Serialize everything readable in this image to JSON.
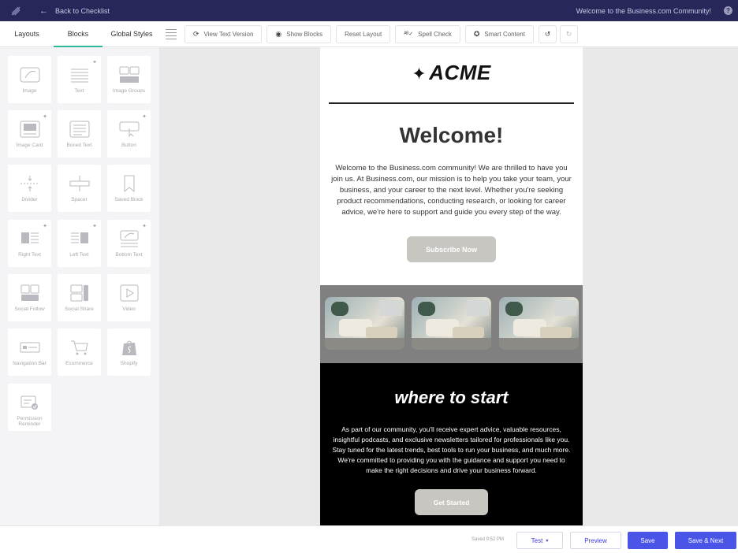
{
  "topbar": {
    "back_label": "Back to Checklist",
    "title": "Welcome to the Business.com Community!",
    "help_label": "?"
  },
  "toolbar": {
    "tabs": [
      {
        "label": "Layouts"
      },
      {
        "label": "Blocks"
      },
      {
        "label": "Global Styles"
      }
    ],
    "active_tab": "Blocks",
    "buttons": [
      {
        "label": "View Text Version",
        "icon": "refresh-icon"
      },
      {
        "label": "Show Blocks",
        "icon": "eye-icon"
      },
      {
        "label": "Reset Layout",
        "icon": ""
      },
      {
        "label": "Spell Check",
        "icon": "spellcheck-icon"
      },
      {
        "label": "Smart Content",
        "icon": "smart-content-icon"
      }
    ],
    "undo_icon": "undo-icon",
    "redo_icon": "redo-icon"
  },
  "blocks": [
    {
      "label": "Image"
    },
    {
      "label": "Text"
    },
    {
      "label": "Image Groups"
    },
    {
      "label": "Image Card"
    },
    {
      "label": "Boxed Text"
    },
    {
      "label": "Button"
    },
    {
      "label": "Divider"
    },
    {
      "label": "Spacer"
    },
    {
      "label": "Saved Block"
    },
    {
      "label": "Right Text"
    },
    {
      "label": "Left Text"
    },
    {
      "label": "Bottom Text"
    },
    {
      "label": "Social Follow"
    },
    {
      "label": "Social Share"
    },
    {
      "label": "Video"
    },
    {
      "label": "Navigation Bar"
    },
    {
      "label": "Ecommerce"
    },
    {
      "label": "Shopify"
    },
    {
      "label": "Permission Reminder"
    }
  ],
  "email": {
    "logo_star": "✦",
    "logo_text": "ACME",
    "heading": "Welcome!",
    "intro": "Welcome to the Business.com community! We are thrilled to have you join us. At Business.com, our mission is to help you take your team, your business, and your career to the next level. Whether you're seeking product recommendations, conducting research, or looking for career advice, we're here to support and guide you every step of the way.",
    "subscribe_label": "Subscribe Now",
    "section_title": "where to start",
    "section_body": "As part of our community, you'll receive expert advice, valuable resources, insightful podcasts, and exclusive newsletters tailored for professionals like you. Stay tuned for the latest trends, best tools to run your business, and much more. We're committed to providing you with the guidance and support you need to make the right decisions and drive your business forward.",
    "cta_label": "Get Started"
  },
  "footer": {
    "saved_text": "Saved 9:52 PM",
    "test_label": "Test",
    "preview_label": "Preview",
    "save_label": "Save",
    "save_next_label": "Save & Next"
  },
  "colors": {
    "topbar": "#27275a",
    "accent_tab": "#2fb89a",
    "primary_button": "#4a55e8",
    "email_button": "#c8c6c0"
  }
}
